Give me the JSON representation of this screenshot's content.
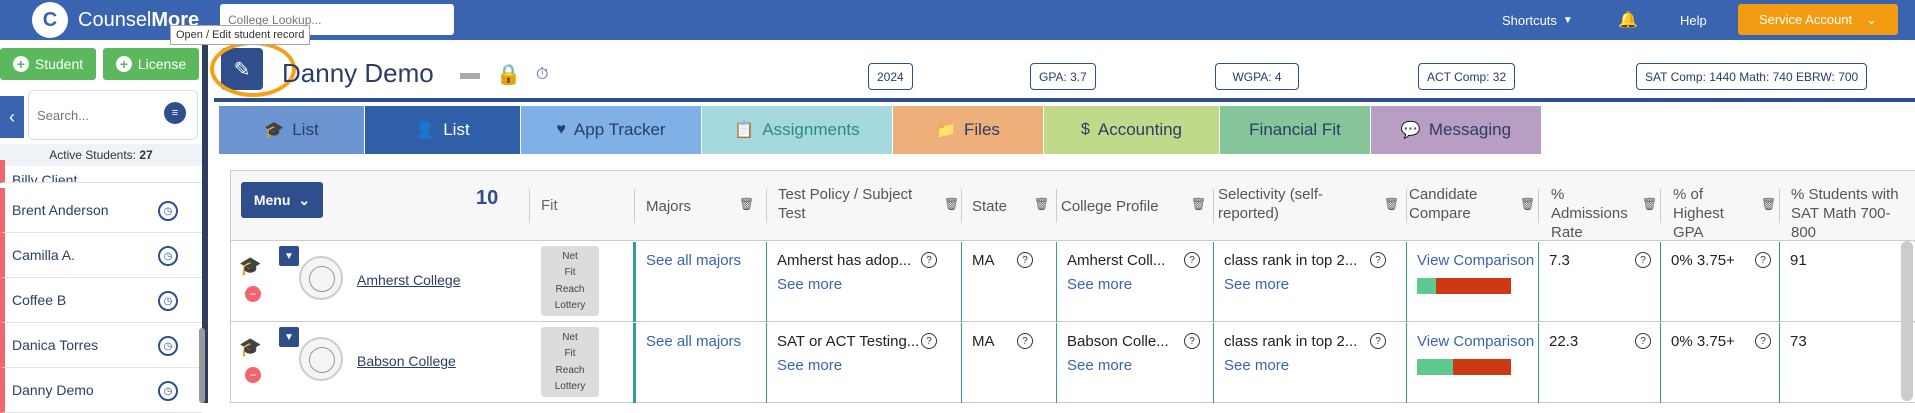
{
  "app": {
    "brand_light": "Counsel",
    "brand_bold": "More",
    "logo_letter": "C"
  },
  "topbar": {
    "college_lookup_placeholder": "College Lookup...",
    "tooltip": "Open / Edit student record",
    "shortcuts": "Shortcuts",
    "bell_icon": "bell-icon",
    "help": "Help",
    "service_account": "Service Account",
    "accent_color": "#f39c12",
    "bar_color": "#3a63b0"
  },
  "sidebar": {
    "student_button": "Student",
    "license_button": "License",
    "search_placeholder": "Search...",
    "active_label": "Active Students:",
    "active_count": "27",
    "students": [
      "Billy Client",
      "Brent Anderson",
      "Camilla A.",
      "Coffee B",
      "Danica Torres",
      "Danny Demo"
    ]
  },
  "header": {
    "student_name": "Danny Demo",
    "pills": [
      "2024",
      "GPA: 3.7",
      "WGPA: 4",
      "ACT Comp: 32",
      "SAT   Comp: 1440   Math: 740   EBRW: 700"
    ]
  },
  "tabs": [
    {
      "label": "List",
      "icon": "graduation-cap-icon",
      "color": "#6b94d1",
      "text_color": "#2a3e66"
    },
    {
      "label": "List",
      "icon": "user-icon",
      "color": "#2f5fa8",
      "text_color": "#ffffff"
    },
    {
      "label": "App Tracker",
      "icon": "heart-icon",
      "color": "#7fb0e6",
      "text_color": "#2a3e66"
    },
    {
      "label": "Assignments",
      "icon": "clipboard-icon",
      "color": "#a6d9dd",
      "text_color": "#2a8a8a"
    },
    {
      "label": "Files",
      "icon": "folder-icon",
      "color": "#eeaf7a",
      "text_color": "#2a3e66"
    },
    {
      "label": "Accounting",
      "icon": "dollar-icon",
      "color": "#c0d98a",
      "text_color": "#2a3e66"
    },
    {
      "label": "Financial Fit",
      "icon": "",
      "color": "#86c49a",
      "text_color": "#2a3e66"
    },
    {
      "label": "Messaging",
      "icon": "chat-icon",
      "color": "#b89ec2",
      "text_color": "#2a3e66"
    }
  ],
  "table": {
    "menu_button": "Menu",
    "count": "10",
    "fit_header": "Fit",
    "columns": [
      "Majors",
      "Test Policy / Subject Test",
      "State",
      "College Profile",
      "Selectivity (self-reported)",
      "Candidate Compare",
      "% Admissions Rate",
      "% of Highest GPA",
      "% Students with SAT Math 700-800"
    ],
    "fit_labels": [
      "Net",
      "Fit",
      "Reach",
      "Lottery"
    ],
    "rows": [
      {
        "college": "Amherst College",
        "majors": "See all majors",
        "test_policy": "Amherst has adop...",
        "see_more": "See more",
        "state": "MA",
        "profile": "Amherst Coll...",
        "selectivity": "class rank in top 2...",
        "compare": "View Comparison",
        "compare_green": 0.2,
        "admissions_rate": "7.3",
        "highest_gpa": "0% 3.75+",
        "sat_math": "91"
      },
      {
        "college": "Babson College",
        "majors": "See all majors",
        "test_policy": "SAT or ACT Testing...",
        "see_more": "See more",
        "state": "MA",
        "profile": "Babson Colle...",
        "selectivity": "class rank in top 2...",
        "compare": "View Comparison",
        "compare_green": 0.38,
        "admissions_rate": "22.3",
        "highest_gpa": "0% 3.75+",
        "sat_math": "73"
      }
    ]
  }
}
